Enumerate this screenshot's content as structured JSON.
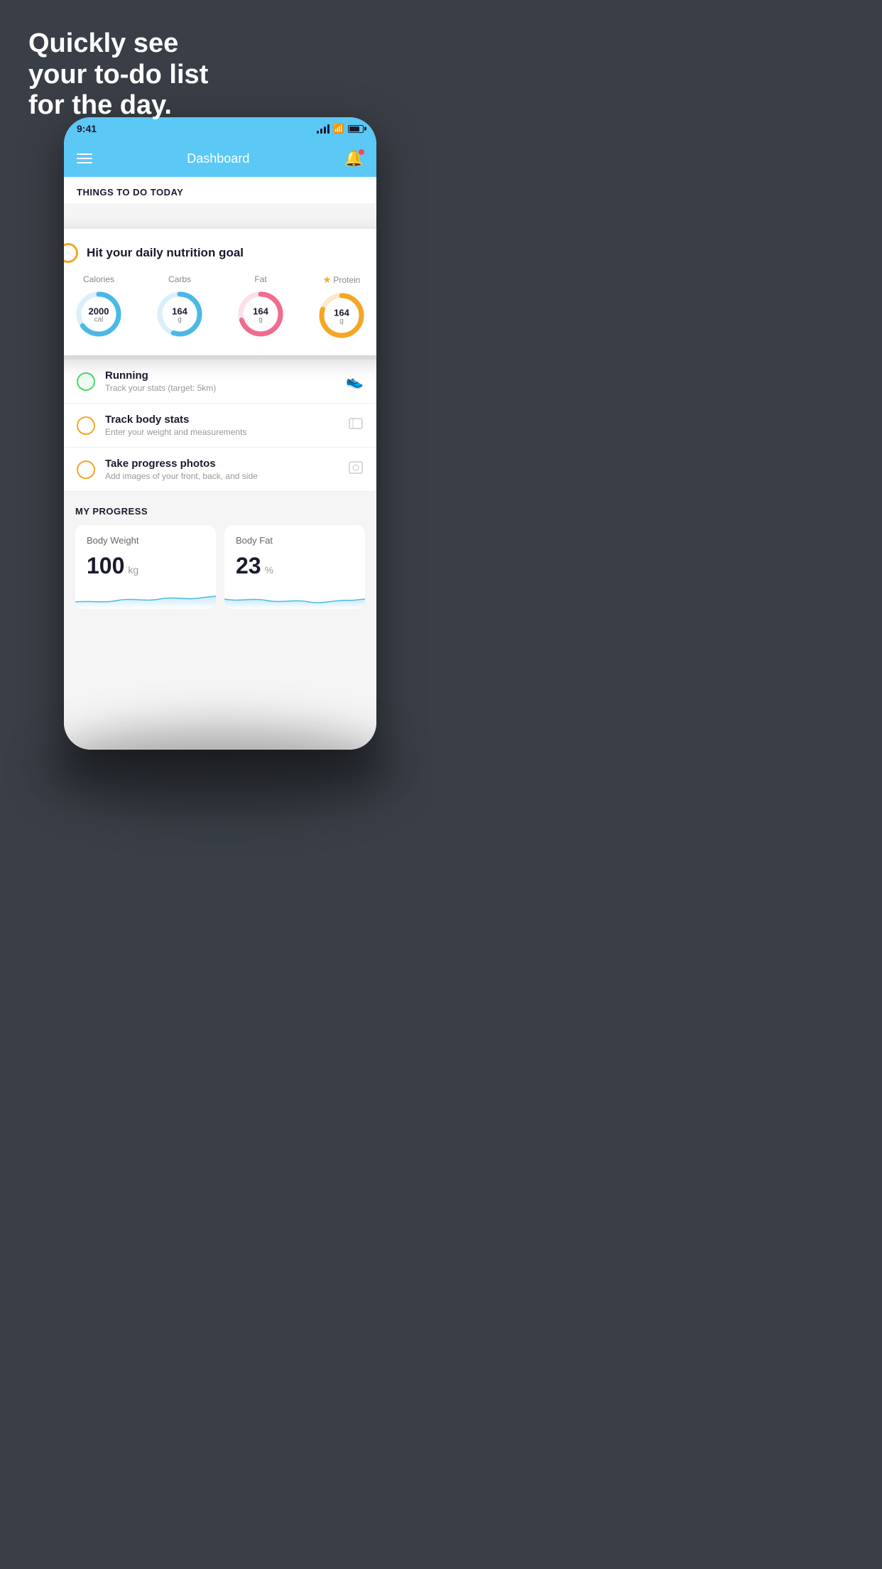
{
  "hero": {
    "line1": "Quickly see",
    "line2": "your to-do list",
    "line3": "for the day."
  },
  "status_bar": {
    "time": "9:41"
  },
  "header": {
    "title": "Dashboard"
  },
  "things_today": {
    "section_label": "THINGS TO DO TODAY"
  },
  "nutrition_card": {
    "title": "Hit your daily nutrition goal",
    "rings": [
      {
        "label": "Calories",
        "value": "2000",
        "unit": "cal",
        "color": "#4cb8e8",
        "track": "#d9f0fb",
        "pct": 65,
        "starred": false
      },
      {
        "label": "Carbs",
        "value": "164",
        "unit": "g",
        "color": "#4cb8e8",
        "track": "#d9f0fb",
        "pct": 55,
        "starred": false
      },
      {
        "label": "Fat",
        "value": "164",
        "unit": "g",
        "color": "#f06b8c",
        "track": "#fce0e8",
        "pct": 70,
        "starred": false
      },
      {
        "label": "Protein",
        "value": "164",
        "unit": "g",
        "color": "#f5a623",
        "track": "#fde9c8",
        "pct": 80,
        "starred": true
      }
    ]
  },
  "todo_items": [
    {
      "title": "Running",
      "subtitle": "Track your stats (target: 5km)",
      "circle": "green",
      "icon": "👟"
    },
    {
      "title": "Track body stats",
      "subtitle": "Enter your weight and measurements",
      "circle": "yellow",
      "icon": "⊡"
    },
    {
      "title": "Take progress photos",
      "subtitle": "Add images of your front, back, and side",
      "circle": "yellow",
      "icon": "👤"
    }
  ],
  "my_progress": {
    "section_label": "MY PROGRESS",
    "cards": [
      {
        "title": "Body Weight",
        "value": "100",
        "unit": "kg"
      },
      {
        "title": "Body Fat",
        "value": "23",
        "unit": "%"
      }
    ]
  }
}
